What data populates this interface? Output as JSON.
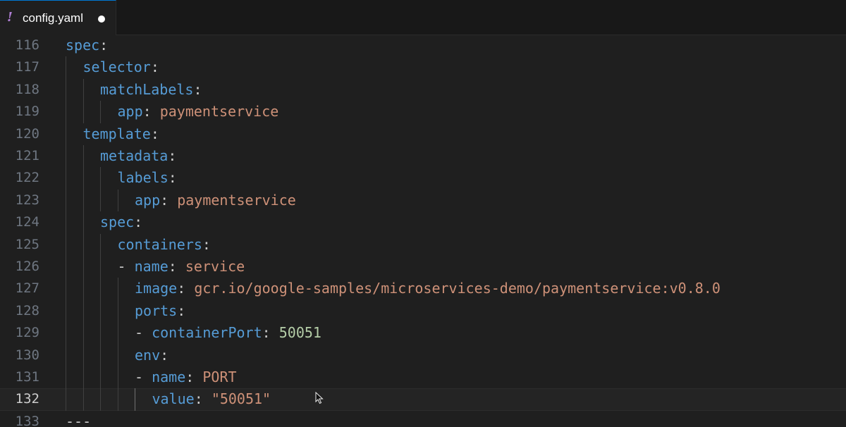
{
  "tab": {
    "icon": "!",
    "label": "config.yaml",
    "dirty_indicator": "dirty-dot"
  },
  "colors": {
    "key": "#569cd6",
    "string": "#ce9178",
    "number": "#b5cea8",
    "punctuation": "#cccccc",
    "line_number": "#6e7681",
    "background": "#1f1f1f"
  },
  "editor": {
    "current_line": "132",
    "lines": [
      {
        "num": "116",
        "indent": 0,
        "dash": "",
        "key": "spec",
        "colon": ":",
        "value": "",
        "vtype": ""
      },
      {
        "num": "117",
        "indent": 1,
        "dash": "",
        "key": "selector",
        "colon": ":",
        "value": "",
        "vtype": ""
      },
      {
        "num": "118",
        "indent": 2,
        "dash": "",
        "key": "matchLabels",
        "colon": ":",
        "value": "",
        "vtype": ""
      },
      {
        "num": "119",
        "indent": 3,
        "dash": "",
        "key": "app",
        "colon": ":",
        "value": "paymentservice",
        "vtype": "s"
      },
      {
        "num": "120",
        "indent": 1,
        "dash": "",
        "key": "template",
        "colon": ":",
        "value": "",
        "vtype": ""
      },
      {
        "num": "121",
        "indent": 2,
        "dash": "",
        "key": "metadata",
        "colon": ":",
        "value": "",
        "vtype": ""
      },
      {
        "num": "122",
        "indent": 3,
        "dash": "",
        "key": "labels",
        "colon": ":",
        "value": "",
        "vtype": ""
      },
      {
        "num": "123",
        "indent": 4,
        "dash": "",
        "key": "app",
        "colon": ":",
        "value": "paymentservice",
        "vtype": "s"
      },
      {
        "num": "124",
        "indent": 2,
        "dash": "",
        "key": "spec",
        "colon": ":",
        "value": "",
        "vtype": ""
      },
      {
        "num": "125",
        "indent": 3,
        "dash": "",
        "key": "containers",
        "colon": ":",
        "value": "",
        "vtype": ""
      },
      {
        "num": "126",
        "indent": 3,
        "dash": "- ",
        "key": "name",
        "colon": ":",
        "value": "service",
        "vtype": "s"
      },
      {
        "num": "127",
        "indent": 4,
        "dash": "",
        "key": "image",
        "colon": ":",
        "value": "gcr.io/google-samples/microservices-demo/paymentservice:v0.8.0",
        "vtype": "s"
      },
      {
        "num": "128",
        "indent": 4,
        "dash": "",
        "key": "ports",
        "colon": ":",
        "value": "",
        "vtype": ""
      },
      {
        "num": "129",
        "indent": 4,
        "dash": "- ",
        "key": "containerPort",
        "colon": ":",
        "value": "50051",
        "vtype": "n"
      },
      {
        "num": "130",
        "indent": 4,
        "dash": "",
        "key": "env",
        "colon": ":",
        "value": "",
        "vtype": ""
      },
      {
        "num": "131",
        "indent": 4,
        "dash": "- ",
        "key": "name",
        "colon": ":",
        "value": "PORT",
        "vtype": "s"
      },
      {
        "num": "132",
        "indent": 5,
        "dash": "",
        "key": "value",
        "colon": ":",
        "value": "\"50051\"",
        "vtype": "s"
      },
      {
        "num": "133",
        "indent": 0,
        "dash": "",
        "key": "",
        "colon": "",
        "value": "---",
        "vtype": "p"
      }
    ]
  }
}
